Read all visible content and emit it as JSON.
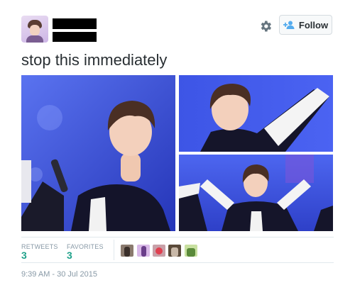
{
  "tweet": {
    "text": "stop this immediately",
    "timestamp": "9:39 AM - 30 Jul 2015"
  },
  "header": {
    "follow_label": "Follow",
    "accent_color": "#55acee"
  },
  "stats": {
    "retweets_label": "RETWEETS",
    "retweets_value": "3",
    "favorites_label": "FAVORITES",
    "favorites_value": "3",
    "value_color": "#1ea18a"
  },
  "icons": {
    "settings": "gear-icon",
    "follow": "add-user-icon"
  },
  "favoriters": [
    {
      "colors": [
        "#8a7a6e",
        "#3a2f2a"
      ]
    },
    {
      "colors": [
        "#d9b9e8",
        "#6a3e8a"
      ]
    },
    {
      "colors": [
        "#c8a0a8",
        "#e04050"
      ]
    },
    {
      "colors": [
        "#5a4a3a",
        "#c8b8a8"
      ]
    },
    {
      "colors": [
        "#c8e0a0",
        "#5a8a3a"
      ]
    }
  ]
}
